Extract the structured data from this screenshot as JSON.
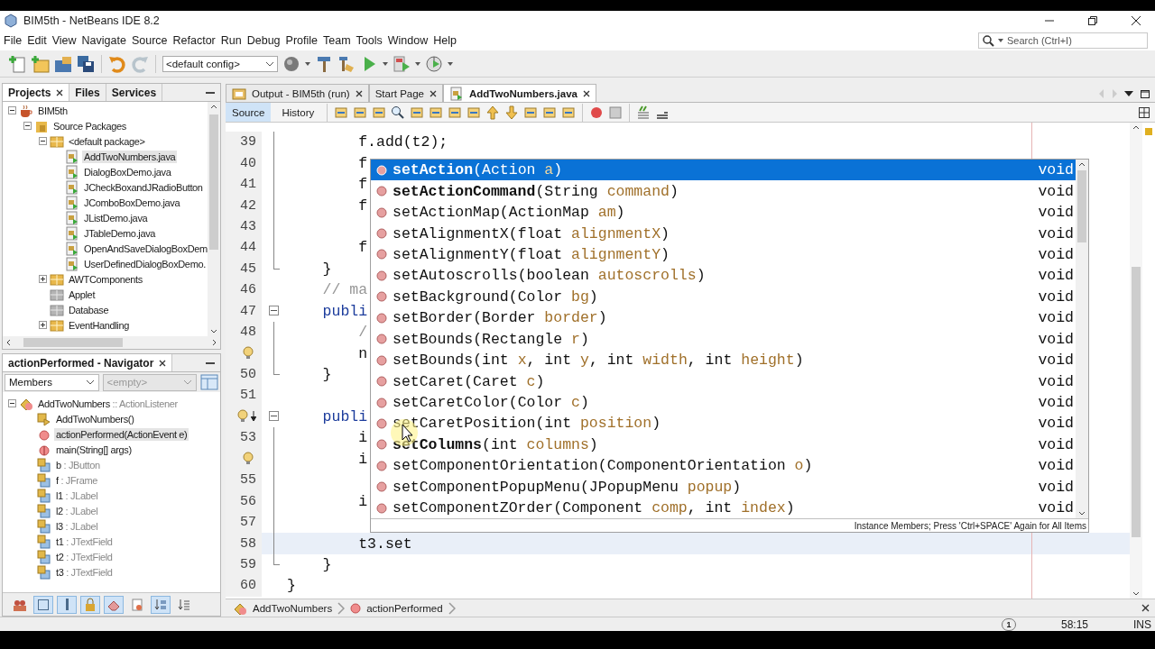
{
  "window": {
    "title": "BIM5th - NetBeans IDE 8.2"
  },
  "menu": [
    "File",
    "Edit",
    "View",
    "Navigate",
    "Source",
    "Refactor",
    "Run",
    "Debug",
    "Profile",
    "Team",
    "Tools",
    "Window",
    "Help"
  ],
  "search": {
    "placeholder": "Search (Ctrl+I)"
  },
  "toolbar": {
    "config": "<default config>"
  },
  "projects_panel": {
    "tabs": [
      {
        "label": "Projects",
        "selected": true
      },
      {
        "label": "Files",
        "selected": false
      },
      {
        "label": "Services",
        "selected": false
      }
    ],
    "tree": [
      {
        "label": "BIM5th",
        "kind": "project",
        "expanded": true,
        "selected": false,
        "children": [
          {
            "label": "Source Packages",
            "kind": "source-folder",
            "expanded": true,
            "selected": false,
            "children": [
              {
                "label": "<default package>",
                "kind": "package",
                "expanded": true,
                "selected": false,
                "children": [
                  {
                    "label": "AddTwoNumbers.java",
                    "kind": "java-file",
                    "selected": true
                  },
                  {
                    "label": "DialogBoxDemo.java",
                    "kind": "java-file",
                    "selected": false
                  },
                  {
                    "label": "JCheckBoxandJRadioButton",
                    "kind": "java-file",
                    "selected": false
                  },
                  {
                    "label": "JComboBoxDemo.java",
                    "kind": "java-file",
                    "selected": false
                  },
                  {
                    "label": "JListDemo.java",
                    "kind": "java-file",
                    "selected": false
                  },
                  {
                    "label": "JTableDemo.java",
                    "kind": "java-file",
                    "selected": false
                  },
                  {
                    "label": "OpenAndSaveDialogBoxDem",
                    "kind": "java-file",
                    "selected": false
                  },
                  {
                    "label": "UserDefinedDialogBoxDemo.",
                    "kind": "java-file",
                    "selected": false
                  }
                ]
              },
              {
                "label": "AWTComponents",
                "kind": "package",
                "expanded": false,
                "selected": false
              },
              {
                "label": "Applet",
                "kind": "empty-package",
                "selected": false
              },
              {
                "label": "Database",
                "kind": "empty-package",
                "selected": false
              },
              {
                "label": "EventHandling",
                "kind": "package",
                "expanded": false,
                "selected": false
              }
            ]
          }
        ]
      }
    ]
  },
  "navigator": {
    "title": "actionPerformed - Navigator",
    "filter": "Members",
    "scope": {
      "value": "<empty>",
      "disabled": true
    },
    "root": {
      "name": "AddTwoNumbers",
      "type": ":: ActionListener",
      "expanded": true
    },
    "members": [
      {
        "name": "AddTwoNumbers()",
        "kind": "constructor",
        "selected": false
      },
      {
        "name": "actionPerformed(ActionEvent e)",
        "kind": "method",
        "selected": true
      },
      {
        "name": "main(String[] args)",
        "kind": "static-method",
        "selected": false
      },
      {
        "name": "b",
        "type": ": JButton",
        "kind": "field",
        "selected": false
      },
      {
        "name": "f",
        "type": ": JFrame",
        "kind": "field",
        "selected": false
      },
      {
        "name": "l1",
        "type": ": JLabel",
        "kind": "field",
        "selected": false
      },
      {
        "name": "l2",
        "type": ": JLabel",
        "kind": "field",
        "selected": false
      },
      {
        "name": "l3",
        "type": ": JLabel",
        "kind": "field",
        "selected": false
      },
      {
        "name": "t1",
        "type": ": JTextField",
        "kind": "field",
        "selected": false
      },
      {
        "name": "t2",
        "type": ": JTextField",
        "kind": "field",
        "selected": false
      },
      {
        "name": "t3",
        "type": ": JTextField",
        "kind": "field",
        "selected": false
      }
    ],
    "filters": [
      {
        "kind": "inherited",
        "pressed": false
      },
      {
        "kind": "fields",
        "pressed": true
      },
      {
        "kind": "static",
        "pressed": true
      },
      {
        "kind": "private",
        "pressed": true
      },
      {
        "kind": "local-classes",
        "pressed": true
      },
      {
        "kind": "javadoc",
        "pressed": false
      },
      {
        "kind": "sort-name",
        "pressed": true
      },
      {
        "kind": "sort-source",
        "pressed": false
      }
    ]
  },
  "editor": {
    "tabs": [
      {
        "label": "Output - BIM5th (run)",
        "kind": "output",
        "selected": false
      },
      {
        "label": "Start Page",
        "kind": "page",
        "selected": false
      },
      {
        "label": "AddTwoNumbers.java",
        "kind": "java",
        "selected": true
      }
    ],
    "views": [
      {
        "label": "Source",
        "selected": true
      },
      {
        "label": "History",
        "selected": false
      }
    ],
    "lines": [
      {
        "number": "39",
        "text": "        f.add(t2);",
        "kind": "code",
        "in_fold": true,
        "fold_toggle": false,
        "fold_end": false,
        "current": false
      },
      {
        "number": "40",
        "text": "        f",
        "kind": "code",
        "in_fold": true,
        "fold_toggle": false,
        "fold_end": false,
        "current": false
      },
      {
        "number": "41",
        "text": "        f",
        "kind": "code",
        "in_fold": true,
        "fold_toggle": false,
        "fold_end": false,
        "current": false
      },
      {
        "number": "42",
        "text": "        f",
        "kind": "code",
        "in_fold": true,
        "fold_toggle": false,
        "fold_end": false,
        "current": false
      },
      {
        "number": "43",
        "in_fold": true,
        "fold_toggle": false,
        "fold_end": false,
        "current": false
      },
      {
        "number": "44",
        "text": "        f",
        "kind": "code",
        "in_fold": true,
        "fold_toggle": false,
        "fold_end": false,
        "current": false
      },
      {
        "number": "45",
        "text": "    }",
        "kind": "code",
        "in_fold": false,
        "fold_toggle": false,
        "fold_end": true,
        "current": false
      },
      {
        "number": "46",
        "text": "    // ma",
        "kind": "comment",
        "in_fold": false,
        "fold_toggle": false,
        "fold_end": false,
        "current": false
      },
      {
        "number": "47",
        "text": "    publi",
        "kind": "keyword",
        "in_fold": false,
        "fold_toggle": true,
        "fold_end": false,
        "current": false
      },
      {
        "number": "48",
        "text": "        /",
        "kind": "comment",
        "in_fold": true,
        "fold_toggle": false,
        "fold_end": false,
        "current": false
      },
      {
        "hint": true,
        "text": "        n",
        "kind": "code",
        "in_fold": true,
        "fold_toggle": false,
        "fold_end": false,
        "current": false
      },
      {
        "number": "50",
        "text": "    }",
        "kind": "code",
        "in_fold": false,
        "fold_toggle": false,
        "fold_end": true,
        "current": false
      },
      {
        "number": "51",
        "in_fold": false,
        "fold_toggle": false,
        "fold_end": false,
        "current": false
      },
      {
        "hint": true,
        "overrides": true,
        "text": "    publi",
        "kind": "keyword",
        "in_fold": false,
        "fold_toggle": true,
        "fold_end": false,
        "current": false
      },
      {
        "number": "53",
        "text": "        i",
        "kind": "code",
        "in_fold": true,
        "fold_toggle": false,
        "fold_end": false,
        "current": false
      },
      {
        "hint": true,
        "text": "        i",
        "kind": "code",
        "in_fold": true,
        "fold_toggle": false,
        "fold_end": false,
        "current": false
      },
      {
        "number": "55",
        "in_fold": true,
        "fold_toggle": false,
        "fold_end": false,
        "current": false
      },
      {
        "number": "56",
        "text": "        i",
        "kind": "code",
        "in_fold": true,
        "fold_toggle": false,
        "fold_end": false,
        "current": false
      },
      {
        "number": "57",
        "in_fold": true,
        "fold_toggle": false,
        "fold_end": false,
        "current": false
      },
      {
        "number": "58",
        "text": "        t3.set",
        "kind": "code",
        "in_fold": true,
        "fold_toggle": false,
        "fold_end": false,
        "current": true
      },
      {
        "number": "59",
        "text": "    }",
        "kind": "code",
        "in_fold": false,
        "fold_toggle": false,
        "fold_end": true,
        "current": false
      },
      {
        "number": "60",
        "text": "}",
        "kind": "code",
        "in_fold": false,
        "fold_toggle": false,
        "fold_end": false,
        "current": false
      }
    ],
    "completion": {
      "items": [
        {
          "name": "setAction",
          "parts": [
            "(Action ",
            "a",
            ")"
          ],
          "returns": "void",
          "bold": true,
          "selected": true
        },
        {
          "name": "setActionCommand",
          "parts": [
            "(String ",
            "command",
            ")"
          ],
          "returns": "void",
          "bold": true,
          "selected": false
        },
        {
          "name": "setActionMap",
          "parts": [
            "(ActionMap ",
            "am",
            ")"
          ],
          "returns": "void",
          "bold": false,
          "selected": false
        },
        {
          "name": "setAlignmentX",
          "parts": [
            "(float ",
            "alignmentX",
            ")"
          ],
          "returns": "void",
          "bold": false,
          "selected": false
        },
        {
          "name": "setAlignmentY",
          "parts": [
            "(float ",
            "alignmentY",
            ")"
          ],
          "returns": "void",
          "bold": false,
          "selected": false
        },
        {
          "name": "setAutoscrolls",
          "parts": [
            "(boolean ",
            "autoscrolls",
            ")"
          ],
          "returns": "void",
          "bold": false,
          "selected": false
        },
        {
          "name": "setBackground",
          "parts": [
            "(Color ",
            "bg",
            ")"
          ],
          "returns": "void",
          "bold": false,
          "selected": false
        },
        {
          "name": "setBorder",
          "parts": [
            "(Border ",
            "border",
            ")"
          ],
          "returns": "void",
          "bold": false,
          "selected": false
        },
        {
          "name": "setBounds",
          "parts": [
            "(Rectangle ",
            "r",
            ")"
          ],
          "returns": "void",
          "bold": false,
          "selected": false
        },
        {
          "name": "setBounds",
          "parts": [
            "(int ",
            "x",
            ", int ",
            "y",
            ", int ",
            "width",
            ", int ",
            "height",
            ")"
          ],
          "returns": "void",
          "bold": false,
          "selected": false
        },
        {
          "name": "setCaret",
          "parts": [
            "(Caret ",
            "c",
            ")"
          ],
          "returns": "void",
          "bold": false,
          "selected": false
        },
        {
          "name": "setCaretColor",
          "parts": [
            "(Color ",
            "c",
            ")"
          ],
          "returns": "void",
          "bold": false,
          "selected": false
        },
        {
          "name": "setCaretPosition",
          "parts": [
            "(int ",
            "position",
            ")"
          ],
          "returns": "void",
          "bold": false,
          "selected": false
        },
        {
          "name": "setColumns",
          "parts": [
            "(int ",
            "columns",
            ")"
          ],
          "returns": "void",
          "bold": true,
          "selected": false
        },
        {
          "name": "setComponentOrientation",
          "parts": [
            "(ComponentOrientation ",
            "o",
            ")"
          ],
          "returns": "void",
          "bold": false,
          "selected": false
        },
        {
          "name": "setComponentPopupMenu",
          "parts": [
            "(JPopupMenu ",
            "popup",
            ")"
          ],
          "returns": "void",
          "bold": false,
          "selected": false
        },
        {
          "name": "setComponentZOrder",
          "parts": [
            "(Component ",
            "comp",
            ", int ",
            "index",
            ")"
          ],
          "returns": "void",
          "bold": false,
          "selected": false
        }
      ],
      "footer": "Instance Members; Press 'Ctrl+SPACE' Again for All Items"
    },
    "breadcrumbs": [
      {
        "label": "AddTwoNumbers",
        "kind": "class"
      },
      {
        "label": "actionPerformed",
        "kind": "method"
      }
    ]
  },
  "status_bar": {
    "notifications": "1",
    "position": "58:15",
    "mode": "INS"
  }
}
